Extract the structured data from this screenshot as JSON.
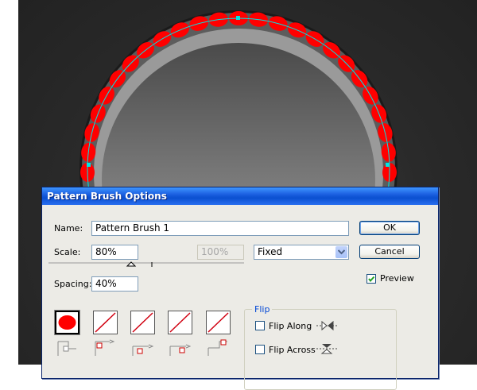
{
  "dialog": {
    "title": "Pattern Brush Options",
    "name_label": "Name:",
    "name_value": "Pattern Brush 1",
    "scale_label": "Scale:",
    "scale_value": "80%",
    "scale_max_value": "100%",
    "scale_mode": "Fixed",
    "spacing_label": "Spacing:",
    "spacing_value": "40%",
    "ok_label": "OK",
    "cancel_label": "Cancel",
    "preview_label": "Preview",
    "preview_checked": true,
    "flip": {
      "group_label": "Flip",
      "along_label": "Flip Along",
      "across_label": "Flip Across",
      "along_checked": false,
      "across_checked": false
    },
    "tiles": [
      {
        "name": "side-tile",
        "content": "red-dot",
        "selected": true
      },
      {
        "name": "outer-corner-tile",
        "content": "none",
        "selected": false
      },
      {
        "name": "inner-corner-tile",
        "content": "none",
        "selected": false
      },
      {
        "name": "start-tile",
        "content": "none",
        "selected": false
      },
      {
        "name": "end-tile",
        "content": "none",
        "selected": false
      }
    ]
  },
  "colors": {
    "accent_red": "#ff0000",
    "path_cyan": "#00e5e5",
    "title_blue": "#1b5fe0"
  }
}
